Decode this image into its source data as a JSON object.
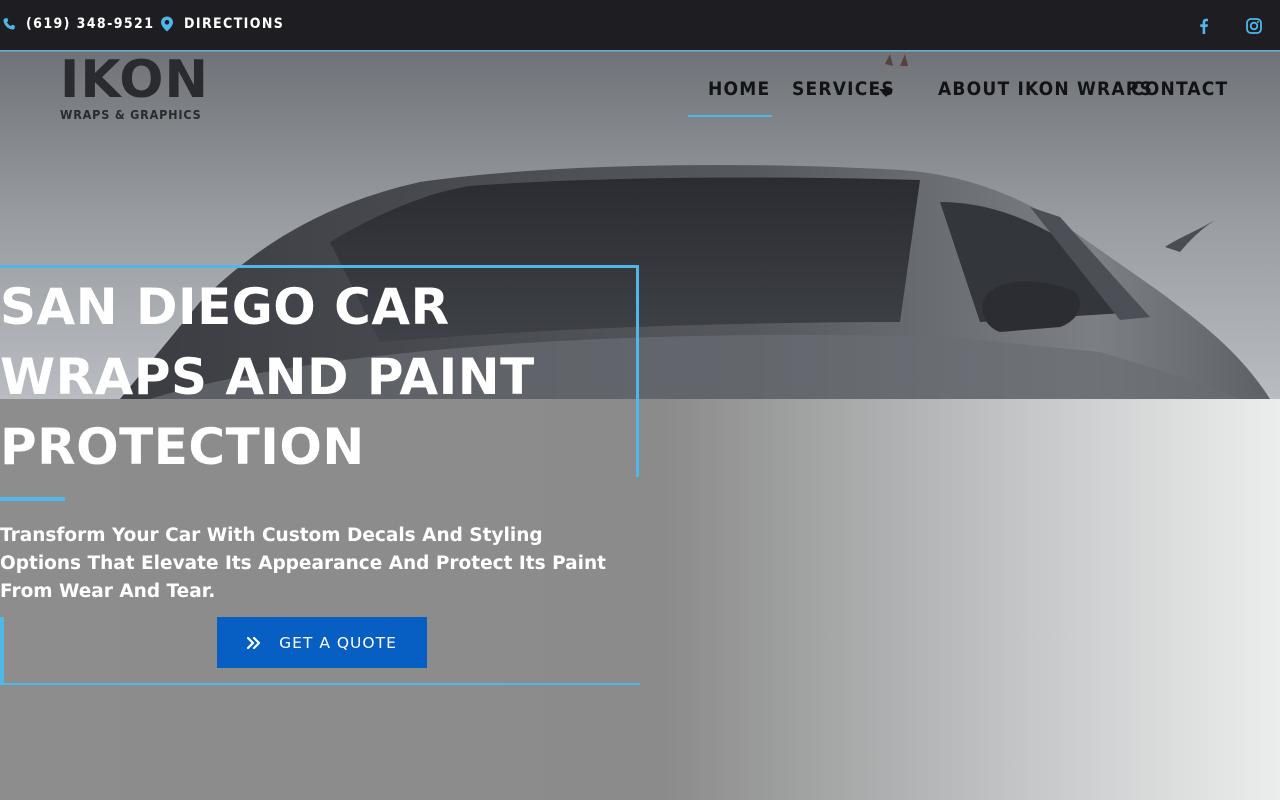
{
  "topbar": {
    "phone": "(619) 348-9521",
    "directions": "DIRECTIONS",
    "icons": [
      "phone-icon",
      "map-pin-icon",
      "facebook-icon",
      "instagram-icon"
    ],
    "accent_color": "#4fb8e8"
  },
  "logo": {
    "main": "IKON",
    "sub": "WRAPS & GRAPHICS"
  },
  "nav": {
    "items": [
      {
        "label": "HOME",
        "active": true
      },
      {
        "label": "SERVICES",
        "has_dropdown": true
      },
      {
        "label": "ABOUT IKON WRAPS"
      },
      {
        "label": "CONTACT"
      }
    ]
  },
  "hero": {
    "headline_lines": [
      "SAN DIEGO CAR",
      "WRAPS AND PAINT",
      "PROTECTION"
    ],
    "subtext": "Transform Your Car With Custom Decals And Styling Options That Elevate Its Appearance And Protect Its Paint From Wear And Tear.",
    "cta_label": "GET A QUOTE",
    "cta_icon": "double-chevron-right-icon",
    "cta_color": "#075fc4"
  }
}
